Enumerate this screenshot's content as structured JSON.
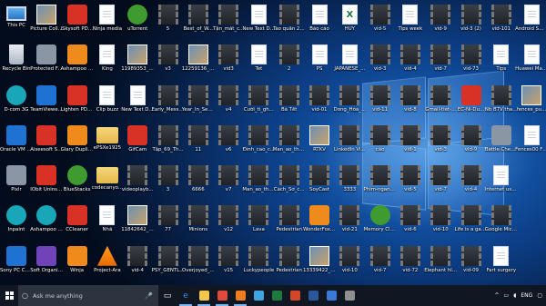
{
  "colors": {
    "accent": "#1e73d2",
    "taskbar": "#101722",
    "search_bg": "#2c3440"
  },
  "desktop": {
    "columns": [
      [
        {
          "label": "This PC",
          "icon": "pc-icon",
          "type": "pc"
        },
        {
          "label": "Recycle Bin",
          "icon": "recycle-bin-icon",
          "type": "bin"
        },
        {
          "label": "D-com 3G",
          "icon": "dcom-icon",
          "type": "teal"
        },
        {
          "label": "Oracle VM VirtualBox",
          "icon": "virtualbox-icon",
          "type": "blue"
        },
        {
          "label": "Pixlr",
          "icon": "pixlr-icon",
          "type": "gray"
        },
        {
          "label": "Inpaint",
          "icon": "inpaint-icon",
          "type": "teal"
        },
        {
          "label": "Sony PC Compani...",
          "icon": "sony-icon",
          "type": "blue"
        }
      ],
      [
        {
          "label": "Picture Colla...",
          "icon": "picture-collage-icon",
          "type": "img"
        },
        {
          "label": "Protected Folder",
          "icon": "protected-folder-icon",
          "type": "gray"
        },
        {
          "label": "TeamViewer 11",
          "icon": "teamviewer-icon",
          "type": "blue"
        },
        {
          "label": "Aiseesoft Screen ...",
          "icon": "aiseesoft-icon",
          "type": "red"
        },
        {
          "label": "IObit Uninstaller",
          "icon": "iobit-icon",
          "type": "red"
        },
        {
          "label": "Ashampoo Photo O...",
          "icon": "ashampoo-photo-icon",
          "type": "teal"
        },
        {
          "label": "Soft Organizer",
          "icon": "soft-organizer-icon",
          "type": "purple"
        }
      ],
      [
        {
          "label": "iSkysoft PDF to Word",
          "icon": "pdf-icon",
          "type": "red"
        },
        {
          "label": "Ashampoo Slidesho...",
          "icon": "ashampoo-slideshow-icon",
          "type": "orange"
        },
        {
          "label": "Lighten PDF to Word",
          "icon": "lighten-pdf-icon",
          "type": "red"
        },
        {
          "label": "Glary Duplica...",
          "icon": "glary-icon",
          "type": "orange"
        },
        {
          "label": "BlueStacks",
          "icon": "bluestacks-icon",
          "type": "green"
        },
        {
          "label": "CCleaner",
          "icon": "ccleaner-icon",
          "type": "red"
        },
        {
          "label": "Winja",
          "icon": "winja-icon",
          "type": "orange"
        }
      ],
      [
        {
          "label": "Ninja media",
          "icon": "file-icon",
          "type": "file"
        },
        {
          "label": "King",
          "icon": "file-icon",
          "type": "file"
        },
        {
          "label": "Clip buzz",
          "icon": "file-icon",
          "type": "file"
        },
        {
          "label": "ePSXe1925",
          "icon": "folder-icon",
          "type": "folder"
        },
        {
          "label": "codecanyo...",
          "icon": "folder-icon",
          "type": "folder"
        },
        {
          "label": "Nhã",
          "icon": "file-icon",
          "type": "file"
        },
        {
          "label": "Project-Ara",
          "icon": "vlc-icon",
          "type": "vlc"
        }
      ],
      [
        {
          "label": "uTorrent",
          "icon": "utorrent-icon",
          "type": "green"
        },
        {
          "label": "11989353_4...",
          "icon": "image-icon",
          "type": "img"
        },
        {
          "label": "New Text Docume...",
          "icon": "text-file-icon",
          "type": "file"
        },
        {
          "label": "GifCam",
          "icon": "gifcam-icon",
          "type": "red"
        },
        {
          "label": "videoplayb...",
          "icon": "video-icon",
          "type": "video"
        },
        {
          "label": "11842642_1...",
          "icon": "image-icon",
          "type": "img"
        },
        {
          "label": "vid-4",
          "icon": "video-icon",
          "type": "video"
        }
      ],
      [
        {
          "label": "5",
          "icon": "video-icon",
          "type": "video"
        },
        {
          "label": "v3",
          "icon": "video-icon",
          "type": "video"
        },
        {
          "label": "Early_Messi...",
          "icon": "video-icon",
          "type": "video"
        },
        {
          "label": "Tập_69_Th...",
          "icon": "video-icon",
          "type": "video"
        },
        {
          "label": "3",
          "icon": "video-icon",
          "type": "video"
        },
        {
          "label": "77",
          "icon": "video-icon",
          "type": "video"
        },
        {
          "label": "PSY_GENTL...",
          "icon": "video-icon",
          "type": "video"
        }
      ],
      [
        {
          "label": "Best_of_W...",
          "icon": "video-icon",
          "type": "video"
        },
        {
          "label": "12259136_1...",
          "icon": "image-icon",
          "type": "img"
        },
        {
          "label": "Year_In_Sea...",
          "icon": "video-icon",
          "type": "video"
        },
        {
          "label": "11",
          "icon": "video-icon",
          "type": "video"
        },
        {
          "label": "6666",
          "icon": "video-icon",
          "type": "video"
        },
        {
          "label": "Minions",
          "icon": "video-icon",
          "type": "video"
        },
        {
          "label": "Overjoyed_...",
          "icon": "video-icon",
          "type": "video"
        }
      ],
      [
        {
          "label": "Tận_mắt_c...",
          "icon": "video-icon",
          "type": "video"
        },
        {
          "label": "vid3",
          "icon": "video-icon",
          "type": "video"
        },
        {
          "label": "v4",
          "icon": "video-icon",
          "type": "video"
        },
        {
          "label": "v6",
          "icon": "video-icon",
          "type": "video"
        },
        {
          "label": "v7",
          "icon": "video-icon",
          "type": "video"
        },
        {
          "label": "v12",
          "icon": "video-icon",
          "type": "video"
        },
        {
          "label": "v15",
          "icon": "video-icon",
          "type": "video"
        }
      ],
      [
        {
          "label": "New Text Docume...",
          "icon": "text-file-icon",
          "type": "file"
        },
        {
          "label": "Tet",
          "icon": "file-icon",
          "type": "file"
        },
        {
          "label": "Cười_tí_gh...",
          "icon": "video-icon",
          "type": "video"
        },
        {
          "label": "Đinh_cao_c...",
          "icon": "video-icon",
          "type": "video"
        },
        {
          "label": "Man_ao_thu...",
          "icon": "video-icon",
          "type": "video"
        },
        {
          "label": "Lava",
          "icon": "video-icon",
          "type": "video"
        },
        {
          "label": "Luckypeople",
          "icon": "video-icon",
          "type": "video"
        }
      ],
      [
        {
          "label": "Tào quân 2016",
          "icon": "video-icon",
          "type": "video"
        },
        {
          "label": "2",
          "icon": "video-icon",
          "type": "video"
        },
        {
          "label": "Bà Tết",
          "icon": "video-icon",
          "type": "video"
        },
        {
          "label": "Man_ao_thu...",
          "icon": "video-icon",
          "type": "video"
        },
        {
          "label": "Cách_Sơ_c...",
          "icon": "video-icon",
          "type": "video"
        },
        {
          "label": "Pedestrian",
          "icon": "video-icon",
          "type": "video"
        },
        {
          "label": "Pedestrian",
          "icon": "video-icon",
          "type": "video"
        }
      ],
      [
        {
          "label": "Báo cáo",
          "icon": "file-icon",
          "type": "file"
        },
        {
          "label": "PS",
          "icon": "file-icon",
          "type": "file"
        },
        {
          "label": "vid-01",
          "icon": "video-icon",
          "type": "video"
        },
        {
          "label": "RTKV",
          "icon": "image-icon",
          "type": "img"
        },
        {
          "label": "SoyCast",
          "icon": "video-icon",
          "type": "video"
        },
        {
          "label": "WonderFox DVD Vide...",
          "icon": "wonderfox-icon",
          "type": "orange"
        },
        {
          "label": "13339422_2...",
          "icon": "image-icon",
          "type": "img"
        }
      ],
      [
        {
          "label": "HUY",
          "icon": "excel-icon",
          "type": "excel"
        },
        {
          "label": "JAPANESE_...",
          "icon": "file-icon",
          "type": "file"
        },
        {
          "label": "Dong_Hoa_...",
          "icon": "video-icon",
          "type": "video"
        },
        {
          "label": "LinkedIn Vi...",
          "icon": "video-icon",
          "type": "video"
        },
        {
          "label": "3333",
          "icon": "video-icon",
          "type": "video"
        },
        {
          "label": "vid-21",
          "icon": "video-icon",
          "type": "video"
        },
        {
          "label": "vid-10",
          "icon": "video-icon",
          "type": "video"
        }
      ],
      [
        {
          "label": "vid-5",
          "icon": "video-icon",
          "type": "video"
        },
        {
          "label": "vid-3",
          "icon": "video-icon",
          "type": "video"
        },
        {
          "label": "vid-11",
          "icon": "video-icon",
          "type": "video"
        },
        {
          "label": "cáo",
          "icon": "video-icon",
          "type": "video"
        },
        {
          "label": "Phim-ngang chat lu...",
          "icon": "video-icon",
          "type": "video"
        },
        {
          "label": "Memory Cleaner",
          "icon": "memory-cleaner-icon",
          "type": "green"
        },
        {
          "label": "vid-7",
          "icon": "video-icon",
          "type": "video"
        }
      ],
      [
        {
          "label": "Tips week",
          "icon": "file-icon",
          "type": "file"
        },
        {
          "label": "vid-4",
          "icon": "video-icon",
          "type": "video"
        },
        {
          "label": "vid-8",
          "icon": "video-icon",
          "type": "video"
        },
        {
          "label": "vid-1",
          "icon": "video-icon",
          "type": "video"
        },
        {
          "label": "vid-5",
          "icon": "video-icon",
          "type": "video"
        },
        {
          "label": "vid-6",
          "icon": "video-icon",
          "type": "video"
        },
        {
          "label": "vid-72",
          "icon": "video-icon",
          "type": "video"
        }
      ],
      [
        {
          "label": "vid-9",
          "icon": "video-icon",
          "type": "video"
        },
        {
          "label": "vid-7",
          "icon": "video-icon",
          "type": "video"
        },
        {
          "label": "Gmail-tiet-...",
          "icon": "video-icon",
          "type": "video"
        },
        {
          "label": "vid-3",
          "icon": "video-icon",
          "type": "video"
        },
        {
          "label": "vid-7",
          "icon": "video-icon",
          "type": "video"
        },
        {
          "label": "vid-10",
          "icon": "video-icon",
          "type": "video"
        },
        {
          "label": "Elephant hluma",
          "icon": "video-icon",
          "type": "video"
        }
      ],
      [
        {
          "label": "vid-3 (2)",
          "icon": "video-icon",
          "type": "video"
        },
        {
          "label": "vid-73",
          "icon": "video-icon",
          "type": "video"
        },
        {
          "label": "EC-Ni-Du...",
          "icon": "pdf-icon",
          "type": "red"
        },
        {
          "label": "vid-9",
          "icon": "video-icon",
          "type": "video"
        },
        {
          "label": "vid-4",
          "icon": "video-icon",
          "type": "video"
        },
        {
          "label": "Life is a game",
          "icon": "video-icon",
          "type": "video"
        },
        {
          "label": "vid-09",
          "icon": "video-icon",
          "type": "video"
        }
      ],
      [
        {
          "label": "vid-101",
          "icon": "video-icon",
          "type": "video"
        },
        {
          "label": "Tips",
          "icon": "file-icon",
          "type": "file"
        },
        {
          "label": "Nb BTV than...",
          "icon": "video-icon",
          "type": "video"
        },
        {
          "label": "Battle Chess 3D",
          "icon": "battle-chess-icon",
          "type": "gray"
        },
        {
          "label": "Internet usage",
          "icon": "file-icon",
          "type": "file"
        },
        {
          "label": "Google Microsoft",
          "icon": "video-icon",
          "type": "video"
        },
        {
          "label": "Fart surgery",
          "icon": "file-icon",
          "type": "file"
        }
      ],
      [
        {
          "label": "Android Smartpho...",
          "icon": "file-icon",
          "type": "file"
        },
        {
          "label": "Huawei Mate 9",
          "icon": "file-icon",
          "type": "file"
        },
        {
          "label": "fences_pu...",
          "icon": "image-icon",
          "type": "img"
        },
        {
          "label": "Fences00 Fences",
          "icon": "file-icon",
          "type": "file"
        }
      ]
    ]
  },
  "taskbar": {
    "search_placeholder": "Ask me anything",
    "mic_icon": "🎤",
    "apps": [
      {
        "name": "task-view-icon",
        "glyph": "▭",
        "color": "#ffffff"
      },
      {
        "name": "edge-icon",
        "glyph": "e",
        "color": "#2f8fe6"
      },
      {
        "name": "file-explorer-icon",
        "glyph": "",
        "color": "#f3c64e"
      },
      {
        "name": "chrome-icon",
        "glyph": "",
        "color": "#e04a3b"
      },
      {
        "name": "firefox-icon",
        "glyph": "",
        "color": "#ef7d1f"
      },
      {
        "name": "photos-icon",
        "glyph": "",
        "color": "#3fa4e0"
      },
      {
        "name": "excel-icon",
        "glyph": "",
        "color": "#1d7a3c"
      },
      {
        "name": "powerpoint-icon",
        "glyph": "",
        "color": "#d24726"
      },
      {
        "name": "word-icon",
        "glyph": "",
        "color": "#2b579a"
      },
      {
        "name": "store-icon",
        "glyph": "",
        "color": "#3a7ad6"
      },
      {
        "name": "media-icon",
        "glyph": "",
        "color": "#8f8f8f"
      }
    ],
    "tray": {
      "language": "ENG",
      "chevron": "^",
      "network": "▭",
      "volume": "◖"
    }
  }
}
